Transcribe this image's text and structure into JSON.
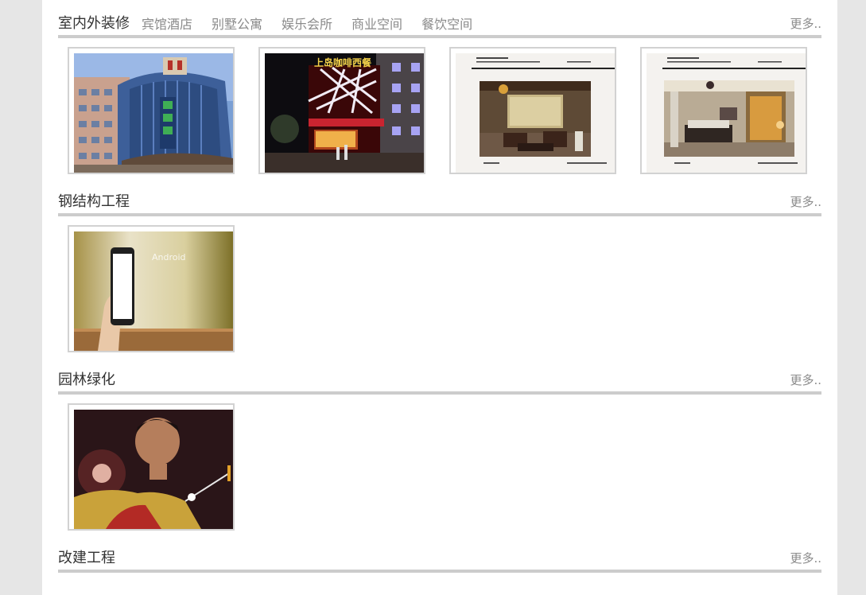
{
  "sections": [
    {
      "title": "室内外装修",
      "tabs": [
        "宾馆酒店",
        "别墅公寓",
        "娱乐会所",
        "商业空间",
        "餐饮空间"
      ],
      "more": "更多..",
      "items": [
        {
          "image": "hotel-building-photo"
        },
        {
          "image": "cafe-facade-night-photo",
          "sign": "上岛咖啡西餐"
        },
        {
          "image": "chinese-style-interior-render"
        },
        {
          "image": "modern-style-interior-render"
        }
      ]
    },
    {
      "title": "钢结构工程",
      "more": "更多..",
      "items": [
        {
          "image": "hand-holding-phone-photo",
          "overlay": "Android"
        }
      ]
    },
    {
      "title": "园林绿化",
      "more": "更多..",
      "items": [
        {
          "image": "badminton-player-photo"
        }
      ]
    },
    {
      "title": "改建工程",
      "more": "更多.."
    }
  ]
}
